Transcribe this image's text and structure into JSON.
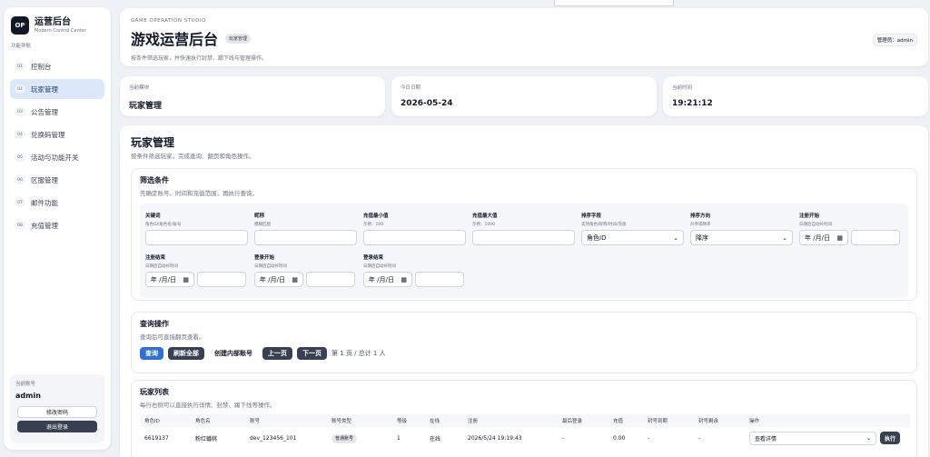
{
  "brand": {
    "logo": "OP",
    "title": "运营后台",
    "subtitle": "Modern Control Center"
  },
  "sidebar": {
    "caption": "功能导航",
    "items": [
      {
        "num": "01",
        "label": "控制台"
      },
      {
        "num": "02",
        "label": "玩家管理",
        "active": true
      },
      {
        "num": "03",
        "label": "公告管理"
      },
      {
        "num": "04",
        "label": "兑换码管理"
      },
      {
        "num": "05",
        "label": "活动与功能开关"
      },
      {
        "num": "06",
        "label": "区服管理"
      },
      {
        "num": "07",
        "label": "邮件功能"
      },
      {
        "num": "08",
        "label": "充值管理"
      }
    ],
    "account": {
      "caption": "当前账号",
      "name": "admin",
      "change_password": "修改密码",
      "logout": "退出登录"
    }
  },
  "header": {
    "studio": "GAME OPERATION STUDIO",
    "title": "游戏运营后台",
    "badge": "玩家管理",
    "desc": "按条件筛选玩家，并快速执行封禁、踢下线与管理操作。",
    "operator": "管理员：admin"
  },
  "info_cards": [
    {
      "caption": "当前模块",
      "value": "玩家管理"
    },
    {
      "caption": "今日日期",
      "value": "2026-05-24"
    },
    {
      "caption": "当前时间",
      "value": "19:21:12"
    }
  ],
  "main": {
    "title": "玩家管理",
    "desc": "按条件筛选玩家，完成查询、翻页和角色操作。",
    "filter": {
      "title": "筛选条件",
      "desc": "先确定账号、时间和充值范围，再执行查询。",
      "fields": {
        "keyword": {
          "label": "关键词",
          "hint": "角色ID/角色名/账号"
        },
        "nickname": {
          "label": "昵称",
          "hint": "模糊匹配"
        },
        "recharge_min": {
          "label": "充值最小值",
          "hint": "示例：100"
        },
        "recharge_max": {
          "label": "充值最大值",
          "hint": "示例：1000"
        },
        "sort_field": {
          "label": "排序字段",
          "hint": "支持角色/昵称/时间/充值",
          "value": "角色ID"
        },
        "sort_order": {
          "label": "排序方向",
          "hint": "升序或降序",
          "value": "降序"
        },
        "reg_start": {
          "label": "注册开始",
          "hint": "日期后自动补时间",
          "date": "年 /月/日"
        },
        "reg_end": {
          "label": "注册结束",
          "hint": "日期后自动补时间",
          "date": "年 /月/日"
        },
        "login_start": {
          "label": "登录开始",
          "hint": "日期后自动补时间",
          "date": "年 /月/日"
        },
        "login_end": {
          "label": "登录结束",
          "hint": "日期后自动补时间",
          "date": "年 /月/日"
        }
      }
    },
    "query": {
      "title": "查询操作",
      "desc": "查询后可直接翻页查看。",
      "search": "查询",
      "refresh_all": "刷新全部",
      "create_internal": "创建内部账号",
      "prev": "上一页",
      "next": "下一页",
      "pager": "第 1 页 / 总计 1 人"
    },
    "list": {
      "title": "玩家列表",
      "desc": "每行右侧可以直接执行详情、封禁、踢下线等操作。",
      "headers": [
        "角色ID",
        "角色名",
        "账号",
        "账号类型",
        "等级",
        "在线",
        "注册",
        "最后登录",
        "充值",
        "封号到期",
        "封号剩余",
        "操作"
      ],
      "rows": [
        {
          "id": "6619137",
          "name": "粉红蟠桃",
          "account": "dev_123456_101",
          "type": "普通账号",
          "level": "1",
          "online": "在线",
          "registered": "2026/5/24 19:19:43",
          "last_login": "-",
          "recharge": "0.00",
          "ban_until": "-",
          "ban_left": "-",
          "action": "查看详情",
          "exec": "执行"
        }
      ]
    }
  }
}
